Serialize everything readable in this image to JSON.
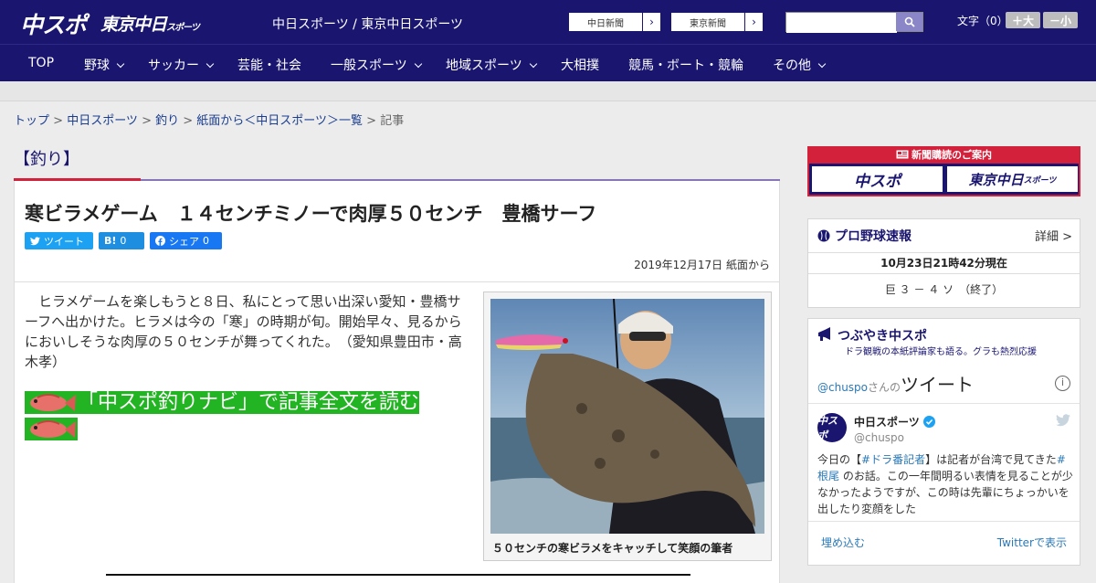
{
  "header": {
    "logo_main": "中スポ",
    "logo_sub": "東京中日",
    "logo_sub_small": "スポーツ",
    "site_name": "中日スポーツ / 東京中日スポーツ",
    "link_chunichi": "中日新聞",
    "link_tokyo": "東京新聞",
    "search_placeholder": "",
    "font_label": "文字（0）",
    "font_up": "＋大",
    "font_down": "－小"
  },
  "nav": {
    "items": [
      {
        "label": "TOP"
      },
      {
        "label": "野球"
      },
      {
        "label": "サッカー"
      },
      {
        "label": "芸能・社会"
      },
      {
        "label": "一般スポーツ"
      },
      {
        "label": "地域スポーツ"
      },
      {
        "label": "大相撲"
      },
      {
        "label": "競馬・ボート・競輪"
      },
      {
        "label": "その他"
      }
    ]
  },
  "breadcrumb": {
    "items": [
      "トップ",
      "中日スポーツ",
      "釣り",
      "紙面から＜中日スポーツ＞一覧"
    ],
    "sep": " > ",
    "current": "記事"
  },
  "article": {
    "category": "【釣り】",
    "headline": "寒ビラメゲーム　１４センチミノーで肉厚５０センチ　豊橋サーフ",
    "share_tweet": "ツイート",
    "share_hatena": "B!",
    "share_hatena_count": "0",
    "share_fb": "シェア",
    "share_fb_count": "0",
    "dateline": "2019年12月17日 紙面から",
    "body": "ヒラメゲームを楽しもうと８日、私にとって思い出深い愛知・豊橋サーフへ出かけた。ヒラメは今の「寒」の時期が旬。開始早々、見るからにおいしそうな肉厚の５０センチが舞ってくれた。　（愛知県豊田市・高木孝）",
    "navi_link": "「中スポ釣りナビ」で記事全文を読む",
    "photo_caption": "５０センチの寒ビラメをキャッチして笑顔の筆者"
  },
  "sidebar": {
    "ad_title": "新聞購読のご案内",
    "ad_left": "中スポ",
    "ad_right": "東京中日",
    "ad_right_small": "スポーツ",
    "baseball": {
      "title": "プロ野球速報",
      "detail": "詳細 >",
      "time": "10月23日21時42分現在",
      "score": "巨 ３ － ４ ソ　（終了）"
    },
    "twitter": {
      "title": "つぶやき中スポ",
      "subtitle": "ドラ観戦の本紙評論家も語る。グラも熱烈応援",
      "handle_link": "@chuspo",
      "handle_suffix": "さんの",
      "head_big": "ツイート",
      "info": "i",
      "account_name": "中日スポーツ",
      "account_handle": "@chuspo",
      "avatar_text": "中スポ",
      "tweet_1": "今日の【",
      "tweet_hash1": "#ドラ番記者",
      "tweet_2": "】は記者が台湾で見てきた",
      "tweet_hash2": "#根尾",
      "tweet_3": " のお話。この一年間明るい表情を見ることが少なかったようですが、この時は先輩にちょっかいを出したり変顔をした",
      "embed": "埋め込む",
      "view_on": "Twitterで表示"
    }
  },
  "colors": {
    "brand": "#1a1670",
    "accent_red": "#d4213b",
    "navi_green": "#22b422",
    "twitter_blue": "#2a79b8",
    "facebook_blue": "#1877f2"
  }
}
